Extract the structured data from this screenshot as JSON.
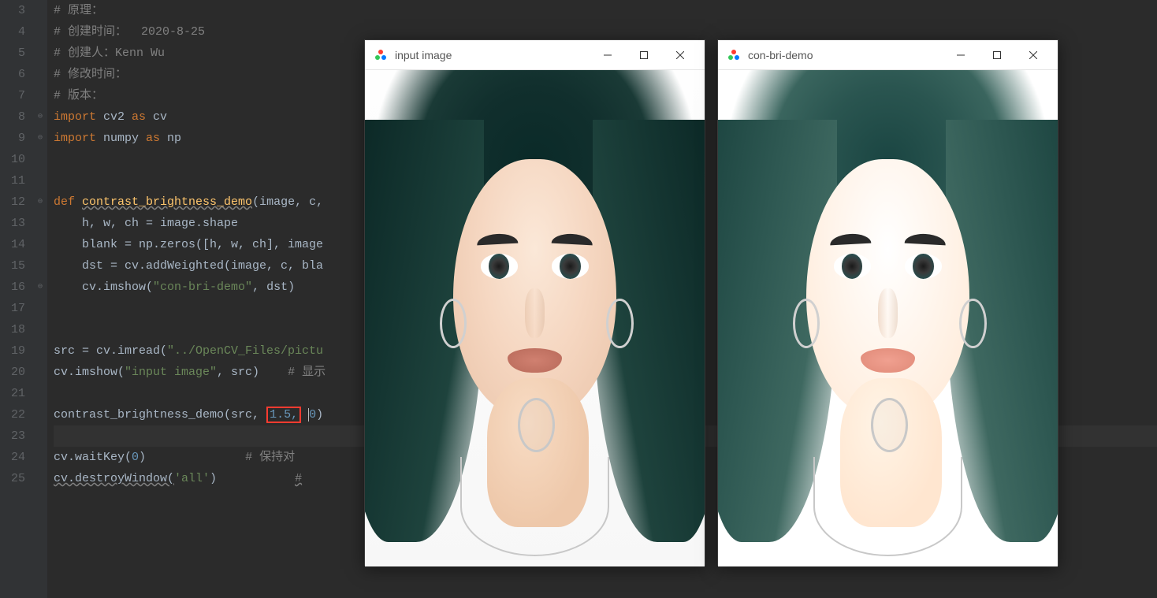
{
  "gutter": [
    "3",
    "4",
    "5",
    "6",
    "7",
    "8",
    "9",
    "10",
    "11",
    "12",
    "13",
    "14",
    "15",
    "16",
    "17",
    "18",
    "19",
    "20",
    "21",
    "22",
    "23",
    "24",
    "25"
  ],
  "code": {
    "c3": "# 原理：",
    "c4": "# 创建时间：  2020-8-25",
    "c5": "# 创建人：Kenn Wu",
    "c6": "# 修改时间：",
    "c7": "# 版本：",
    "l8": {
      "a": "import ",
      "b": "cv2 ",
      "c": "as ",
      "d": "cv"
    },
    "l9": {
      "a": "import ",
      "b": "numpy ",
      "c": "as ",
      "d": "np"
    },
    "l12": {
      "a": "def ",
      "b": "contrast_brightness_demo",
      "c": "(image, c,"
    },
    "l13": "    h, w, ch = image.shape",
    "l14": "    blank = np.zeros([h, w, ch], image",
    "l15": "    dst = cv.addWeighted(image, c, bla",
    "l16": {
      "a": "    cv.imshow(",
      "b": "\"con-bri-demo\"",
      "c": ", dst)"
    },
    "l19": {
      "a": "src = cv.imread(",
      "b": "\"../OpenCV_Files/pictu"
    },
    "l20": {
      "a": "cv.imshow(",
      "b": "\"input image\"",
      "c": ", src)    ",
      "d": "# 显示"
    },
    "l22": {
      "a": "contrast_brightness_demo(src,",
      "b": "1.5,",
      "c": "0",
      "d": ")"
    },
    "l24": {
      "a": "cv.waitKey(",
      "b": "0",
      "c": ")              ",
      "d": "# 保持对"
    },
    "l25": {
      "a": "cv.destroyWindow(",
      "b": "'all'",
      "c": ")           ",
      "d": "#"
    }
  },
  "windows": {
    "win1": {
      "title": "input image"
    },
    "win2": {
      "title": "con-bri-demo"
    }
  }
}
